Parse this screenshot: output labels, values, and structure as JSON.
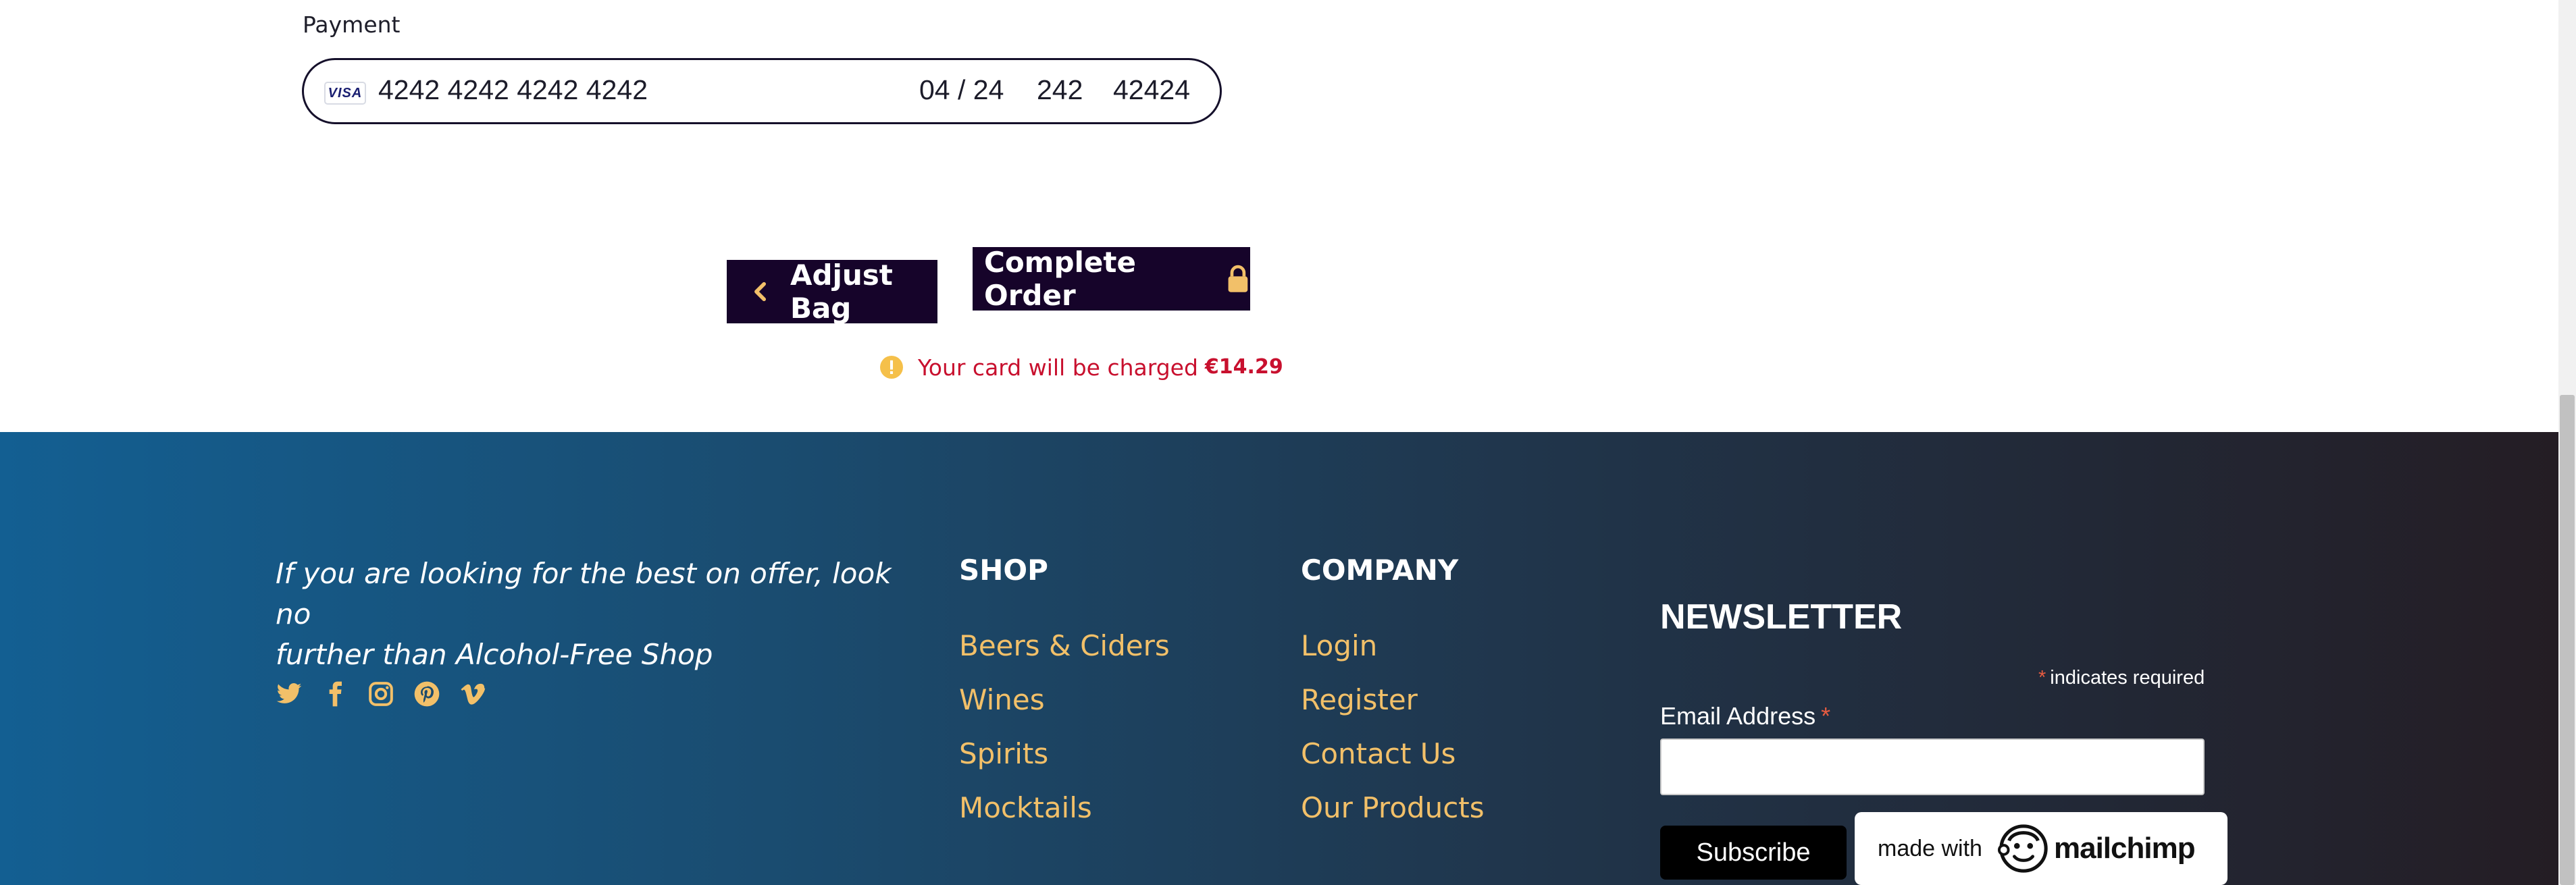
{
  "payment": {
    "label": "Payment",
    "card_brand": "VISA",
    "card_number": "4242 4242 4242 4242",
    "expiry": "04 / 24",
    "cvc": "242",
    "zip": "42424"
  },
  "actions": {
    "adjust_bag": "Adjust Bag",
    "complete_order": "Complete Order",
    "charge_text": "Your card will be charged",
    "charge_amount": "€14.29"
  },
  "footer": {
    "tagline_line1": "If you are looking for the best on offer, look no",
    "tagline_line2": "further than Alcohol-Free Shop",
    "social_icons": [
      "twitter-icon",
      "facebook-icon",
      "instagram-icon",
      "pinterest-icon",
      "vimeo-icon"
    ],
    "shop": {
      "heading": "SHOP",
      "links": [
        "Beers & Ciders",
        "Wines",
        "Spirits",
        "Mocktails"
      ]
    },
    "company": {
      "heading": "COMPANY",
      "links": [
        "Login",
        "Register",
        "Contact Us",
        "Our Products"
      ]
    },
    "newsletter": {
      "heading": "NEWSLETTER",
      "required_star": "*",
      "required_note": "indicates required",
      "email_label": "Email Address",
      "email_value": "",
      "subscribe_label": "Subscribe",
      "badge_made_with": "made with",
      "badge_brand": "mailchimp"
    }
  },
  "colors": {
    "dark_button": "#16042a",
    "accent_gold": "#f2c069",
    "charge_red": "#c8102e",
    "warning_yellow": "#f5c04a"
  }
}
